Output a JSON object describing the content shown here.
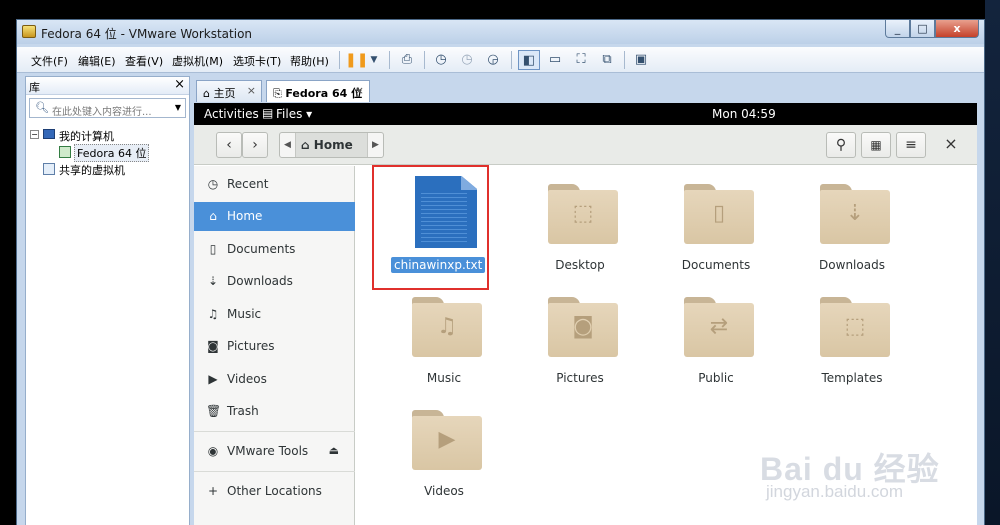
{
  "window": {
    "title": "Fedora 64 位 - VMware Workstation",
    "min": "_",
    "max": "□",
    "close": "x"
  },
  "menu": [
    "文件(F)",
    "编辑(E)",
    "查看(V)",
    "虚拟机(M)",
    "选项卡(T)",
    "帮助(H)"
  ],
  "library": {
    "title": "库",
    "close": "×",
    "search_placeholder": "在此处键入内容进行...",
    "tree": {
      "root": "我的计算机",
      "vm": "Fedora 64 位",
      "shared": "共享的虚拟机"
    }
  },
  "tabs": [
    {
      "label": "主页",
      "close": "×"
    },
    {
      "label": "Fedora 64 位",
      "close": "×"
    }
  ],
  "gnome": {
    "activities": "Activities",
    "app_menu": "Files ▾",
    "clock": "Mon 04:59"
  },
  "nautilus": {
    "path": "Home",
    "sidebar": [
      {
        "label": "Recent",
        "icon": "clock-icon"
      },
      {
        "label": "Home",
        "icon": "home-icon",
        "active": true
      },
      {
        "label": "Documents",
        "icon": "document-icon"
      },
      {
        "label": "Downloads",
        "icon": "download-icon"
      },
      {
        "label": "Music",
        "icon": "music-icon"
      },
      {
        "label": "Pictures",
        "icon": "camera-icon"
      },
      {
        "label": "Videos",
        "icon": "video-icon"
      },
      {
        "label": "Trash",
        "icon": "trash-icon"
      },
      {
        "label": "VMware Tools",
        "icon": "disc-icon"
      },
      {
        "label": "Other Locations",
        "icon": "plus-icon"
      }
    ],
    "files": [
      {
        "name": "chinawinxp.txt",
        "type": "text-file",
        "selected": true
      },
      {
        "name": "Desktop",
        "type": "folder"
      },
      {
        "name": "Documents",
        "type": "folder"
      },
      {
        "name": "Downloads",
        "type": "folder"
      },
      {
        "name": "Music",
        "type": "folder"
      },
      {
        "name": "Pictures",
        "type": "folder"
      },
      {
        "name": "Public",
        "type": "folder"
      },
      {
        "name": "Templates",
        "type": "folder"
      },
      {
        "name": "Videos",
        "type": "folder"
      }
    ]
  },
  "colors": {
    "selection": "#4a90d9",
    "highlight_box": "#e0302c",
    "folder": "#d9c6a4"
  },
  "watermark": {
    "brand": "Bai du 经验",
    "url": "jingyan.baidu.com"
  }
}
